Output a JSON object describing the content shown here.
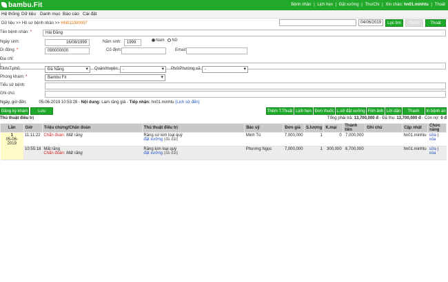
{
  "app": {
    "logo": "bambu.Fit",
    "toplinks": [
      "Bệnh nhân",
      "Lịch hẹn",
      "Đặt xưởng",
      "Thu/Chi"
    ],
    "greeting_prefix": "Xin chào: ",
    "username": "hn01.minhtu",
    "logout": "Thoát"
  },
  "menu": [
    "Hệ thống",
    "Dữ liệu",
    "Danh mục",
    "Báo cáo",
    "Cài đặt"
  ],
  "breadcrumb": {
    "a": "Dữ liệu",
    "sep": " >> ",
    "b": "Hồ sơ bệnh nhân",
    "c": "HN011000007"
  },
  "search": {
    "value": "",
    "date": "04/06/2019",
    "filter_label": "Lọc tìm",
    "add_label": "Thêm",
    "exit_label": "Thoát"
  },
  "form": {
    "name_label": "Tên bệnh nhân:",
    "name": "Hải Đăng",
    "dob_label": "Ngày sinh:",
    "dob": "16/08/1999",
    "yob_label": "Năm sinh:",
    "yob": "1999",
    "male": "Nam",
    "female": "Nữ",
    "mobile_label": "Di động:",
    "mobile": "090000000",
    "landline_label": "Cố định:",
    "landline": "",
    "email_label": "Email:",
    "email": "",
    "address_label": "Địa chỉ:",
    "address": "",
    "province_label": "Tỉnh/T.phố:",
    "province": "Đà Nẵng",
    "district_label": "Quận/Huyện:",
    "district": "-",
    "ward_label": "Phố/Phường xã:",
    "ward": "-",
    "room_label": "Phòng khám:",
    "room": "Bambu Fit",
    "history_label": "Tiểu sử bệnh:",
    "note_label": "Ghi chú:"
  },
  "info": {
    "date_label": "Ngày, giờ đến:",
    "datetime": "05-06-2019 10:53:28",
    "content_label": "Nội dung:",
    "content": "Làm răng giả",
    "receiver_label": "Tiếp nhận:",
    "receiver": "hn01.minhtu",
    "history_link": "(Lịch sử đến)"
  },
  "actions": {
    "register": "Đăng ký khám",
    "save": "Lưu",
    "right": [
      "Thêm T.Thuật",
      "Lịch hẹn",
      "Đơn thuốc",
      "L.sử đặt xưởng",
      "Film ảnh",
      "Lời dặn",
      "Thanh toán",
      "In bệnh án"
    ]
  },
  "treatment": {
    "title": "Thủ thuật điều trị",
    "summary_parts": [
      "Tổng phải trả: ",
      "13,700,000 đ",
      " - Đã thu: ",
      "13,700,000 đ",
      " - Còn nợ: ",
      "0 đ"
    ],
    "headers": [
      "Lần",
      "Giờ",
      "Triệu chứng/Chẩn đoán",
      "Thủ thuật điều trị",
      "Bác sỹ",
      "Đơn giá",
      "S.lượng",
      "K.mại",
      "Thành tiền",
      "Ghi chú",
      "Cập nhật",
      "Chức năng"
    ],
    "rows": [
      {
        "lan": "1",
        "date": "05-06-2019",
        "time": "11:11:22",
        "diag_label": "Chẩn đoán:",
        "diag": "Mất răng",
        "procedure": "Răng sứ kim loại quý",
        "proc_link": "đặt xưởng",
        "proc_status": "(đã đặt)",
        "doctor": "Minh Tú",
        "price": "7,000,000",
        "qty": "1",
        "discount": "0",
        "total": "7,000,000",
        "note": "",
        "updated": "hn01.minhtu",
        "edit": "sửa",
        "del": "xóa"
      },
      {
        "lan": "",
        "date": "",
        "time": "10:55:18",
        "symptom": "Mất răng",
        "diag_label": "Chẩn đoán:",
        "diag": "Mất răng",
        "procedure": "Răng kim loại quý",
        "proc_link": "đặt xưởng",
        "proc_status": "(đã đặt)",
        "doctor": "Phương Ngọc",
        "price": "7,000,000",
        "qty": "1",
        "discount": "300,000",
        "total": "6,700,000",
        "note": "",
        "updated": "hn01.minhtu",
        "edit": "sửa",
        "del": "xóa"
      }
    ]
  }
}
